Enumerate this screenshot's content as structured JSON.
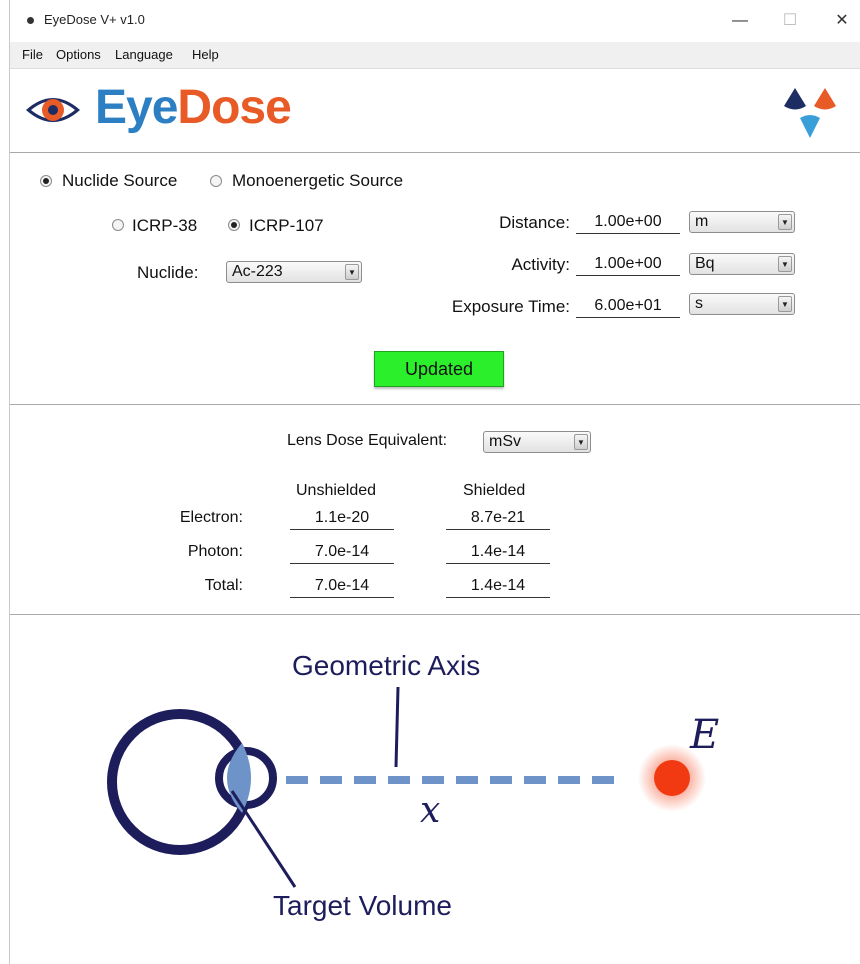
{
  "window": {
    "title": "EyeDose  V+ v1.0",
    "minimize_glyph": "—",
    "maximize_glyph": "☐",
    "close_glyph": "✕"
  },
  "menu": [
    "File",
    "Options",
    "Language",
    "Help"
  ],
  "logo": {
    "part1": "Eye",
    "part2": "Dose"
  },
  "source": {
    "nuclide_label": "Nuclide Source",
    "mono_label": "Monoenergetic Source",
    "selected": "nuclide"
  },
  "icrp": {
    "icrp38_label": "ICRP-38",
    "icrp107_label": "ICRP-107",
    "selected": "ICRP-107"
  },
  "nuclide": {
    "label": "Nuclide:",
    "value": "Ac-223"
  },
  "distance": {
    "label": "Distance:",
    "value": "1.00e+00",
    "unit": "m"
  },
  "activity": {
    "label": "Activity:",
    "value": "1.00e+00",
    "unit": "Bq"
  },
  "exposure": {
    "label": "Exposure Time:",
    "value": "6.00e+01",
    "unit": "s"
  },
  "update_button": {
    "label": "Updated",
    "color": "#2bef2b"
  },
  "dose": {
    "label": "Lens Dose Equivalent:",
    "unit": "mSv",
    "col_unshielded": "Unshielded",
    "col_shielded": "Shielded",
    "rows": [
      {
        "name": "Electron:",
        "unshielded": "1.1e-20",
        "shielded": "8.7e-21"
      },
      {
        "name": "Photon:",
        "unshielded": "7.0e-14",
        "shielded": "1.4e-14"
      },
      {
        "name": "Total:",
        "unshielded": "7.0e-14",
        "shielded": "1.4e-14"
      }
    ]
  },
  "diagram": {
    "axis_label": "Geometric Axis",
    "distance_symbol": "x",
    "energy_symbol": "E",
    "target_label": "Target Volume"
  },
  "colors": {
    "brand_blue": "#2b7fc2",
    "brand_orange": "#e85a26",
    "diagram_navy": "#1e1d5c",
    "source_red": "#f23a12"
  }
}
